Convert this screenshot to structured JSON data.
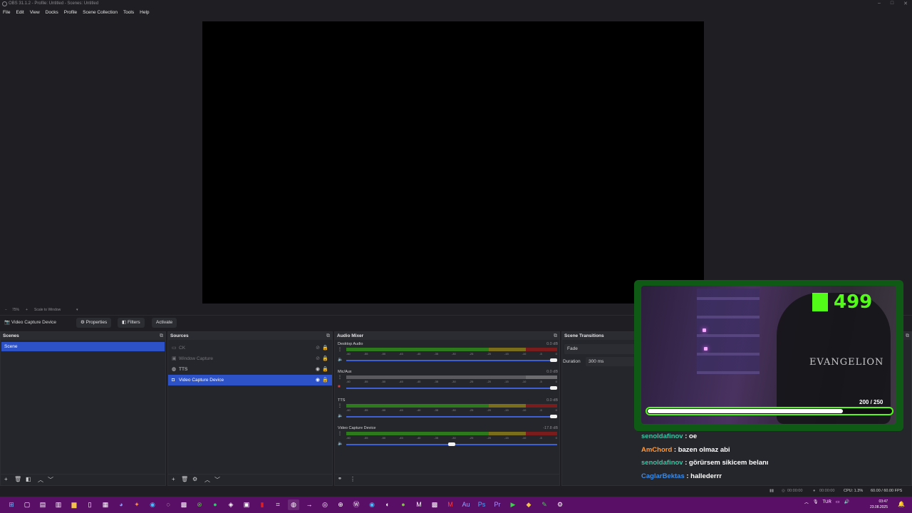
{
  "window": {
    "title": "OBS 31.1.2 - Profile: Untitled - Scenes: Untitled"
  },
  "menu": [
    "File",
    "Edit",
    "View",
    "Docks",
    "Profile",
    "Scene Collection",
    "Tools",
    "Help"
  ],
  "zoombar": {
    "zoom": "75%",
    "scale": "Scale to Window"
  },
  "context": {
    "source": "Video Capture Device",
    "properties": "Properties",
    "filters": "Filters",
    "activate": "Activate"
  },
  "scenes": {
    "title": "Scenes",
    "items": [
      "Scene"
    ]
  },
  "sources": {
    "title": "Sources",
    "items": [
      {
        "label": "CK",
        "icon": "monitor-icon"
      },
      {
        "label": "Window Capture",
        "icon": "window-icon"
      },
      {
        "label": "TTS",
        "icon": "globe-icon"
      },
      {
        "label": "Video Capture Device",
        "icon": "camera-icon"
      }
    ]
  },
  "mixer": {
    "title": "Audio Mixer",
    "ticks": [
      "-60",
      "-55",
      "-50",
      "-45",
      "-40",
      "-35",
      "-30",
      "-25",
      "-20",
      "-15",
      "-10",
      "-5",
      "0"
    ],
    "channels": [
      {
        "name": "Desktop Audio",
        "db": "0.0 dB",
        "muted": false,
        "volume": 1.0
      },
      {
        "name": "Mic/Aux",
        "db": "0.0 dB",
        "muted": true,
        "volume": 1.0
      },
      {
        "name": "TTS",
        "db": "0.0 dB",
        "muted": false,
        "volume": 1.0
      },
      {
        "name": "Video Capture Device",
        "db": "-17.8 dB",
        "muted": false,
        "volume": 0.5
      }
    ]
  },
  "transitions": {
    "title": "Scene Transitions",
    "type": "Fade",
    "duration_label": "Duration",
    "duration": "300 ms"
  },
  "overlay": {
    "kick_count": "499",
    "progress_text": "200 / 250",
    "progress": 0.8
  },
  "chat": [
    {
      "user": "senoldafinov",
      "color": "#3bc4a2",
      "msg": " : oe"
    },
    {
      "user": "AmChord",
      "color": "#ff9a3c",
      "msg": " : bazen olmaz abi"
    },
    {
      "user": "senoldafinov",
      "color": "#3bc4a2",
      "msg": " : görürsem sikicem belanı"
    },
    {
      "user": "CaglarBektas",
      "color": "#3a8be8",
      "msg": " : hallederrr"
    }
  ],
  "statusbar": {
    "rec": "00:00:00",
    "stream": "00:00:00",
    "cpu": "CPU: 1.3%",
    "fps": "60.00 / 60.00 FPS"
  },
  "tray": {
    "lang": "TUR",
    "time": "03:47",
    "date": "23.08.2025"
  },
  "colors": {
    "accent": "#2d51c6",
    "kick_green": "#53fc18",
    "taskbar": "#5a0f66"
  }
}
